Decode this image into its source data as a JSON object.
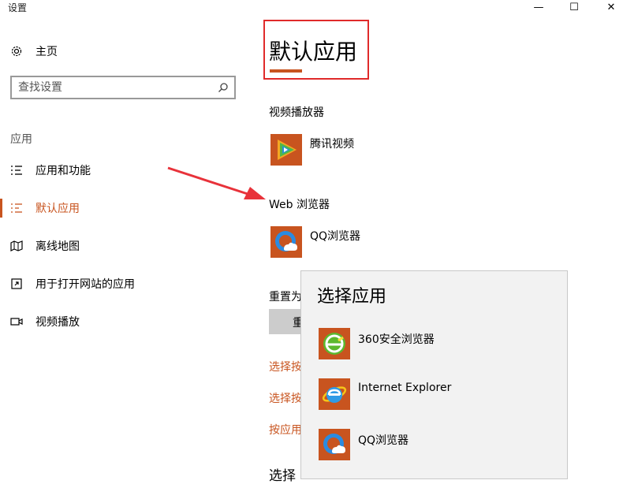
{
  "window": {
    "title": "设置",
    "controls": {
      "minimize": "—",
      "maximize": "☐",
      "close": "✕"
    }
  },
  "sidebar": {
    "home": {
      "label": "主页",
      "icon": "gear-icon"
    },
    "search": {
      "placeholder": "查找设置",
      "icon": "search-icon"
    },
    "section_label": "应用",
    "items": [
      {
        "label": "应用和功能",
        "icon": "list-icon",
        "active": false
      },
      {
        "label": "默认应用",
        "icon": "default-apps-icon",
        "active": true
      },
      {
        "label": "离线地图",
        "icon": "map-icon",
        "active": false
      },
      {
        "label": "用于打开网站的应用",
        "icon": "open-website-icon",
        "active": false
      },
      {
        "label": "视频播放",
        "icon": "video-icon",
        "active": false
      }
    ]
  },
  "main": {
    "title": "默认应用",
    "video_player": {
      "label": "视频播放器",
      "app": "腾讯视频"
    },
    "web_browser": {
      "label": "Web 浏览器",
      "app": "QQ浏览器"
    },
    "reset": {
      "label": "重置为",
      "button_label": "重"
    },
    "links": [
      "选择按",
      "选择按",
      "按应用"
    ],
    "bottom_heading": "选择"
  },
  "popup": {
    "title": "选择应用",
    "items": [
      {
        "label": "360安全浏览器",
        "icon": "360-browser-icon"
      },
      {
        "label": "Internet Explorer",
        "icon": "internet-explorer-icon"
      },
      {
        "label": "QQ浏览器",
        "icon": "qq-browser-icon"
      }
    ]
  },
  "colors": {
    "accent": "#c8541f",
    "highlight_frame": "#e02a2a",
    "arrow": "#e8323a"
  }
}
